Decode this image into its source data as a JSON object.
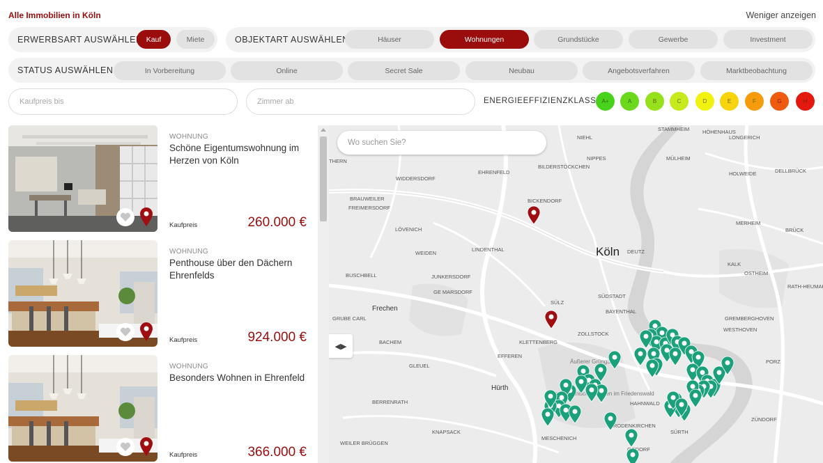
{
  "header": {
    "title": "Alle Immobilien in Köln",
    "less_label": "Weniger anzeigen"
  },
  "acquisition": {
    "label": "ERWERBSART AUSWÄHLEN",
    "options": [
      {
        "label": "Kauf",
        "active": true
      },
      {
        "label": "Miete",
        "active": false
      }
    ]
  },
  "object_type": {
    "label": "OBJEKTART AUSWÄHLEN",
    "options": [
      {
        "label": "Häuser",
        "active": false
      },
      {
        "label": "Wohnungen",
        "active": true
      },
      {
        "label": "Grundstücke",
        "active": false
      },
      {
        "label": "Gewerbe",
        "active": false
      },
      {
        "label": "Investment",
        "active": false
      }
    ]
  },
  "status": {
    "label": "STATUS AUSWÄHLEN",
    "options": [
      {
        "label": "In Vorbereitung"
      },
      {
        "label": "Online"
      },
      {
        "label": "Secret Sale"
      },
      {
        "label": "Neubau"
      },
      {
        "label": "Angebotsverfahren"
      },
      {
        "label": "Marktbeobachtung"
      }
    ]
  },
  "inputs": {
    "price_placeholder": "Kaufpreis bis",
    "rooms_placeholder": "Zimmer ab"
  },
  "energy": {
    "label": "ENERGIEEFFIZIENZKLASSE",
    "classes": [
      {
        "label": "A+",
        "color": "#49d21b"
      },
      {
        "label": "A",
        "color": "#6bd81c"
      },
      {
        "label": "B",
        "color": "#96e01c"
      },
      {
        "label": "C",
        "color": "#c6ea1c"
      },
      {
        "label": "D",
        "color": "#f1f20f"
      },
      {
        "label": "E",
        "color": "#f7d40c"
      },
      {
        "label": "F",
        "color": "#f69b0c"
      },
      {
        "label": "G",
        "color": "#ee5a10"
      },
      {
        "label": "H",
        "color": "#e3180f"
      }
    ]
  },
  "listings": [
    {
      "type": "WOHNUNG",
      "title": "Schöne Eigentumswohnung im Herzen von Köln",
      "price_label": "Kaufpreis",
      "price": "260.000 €"
    },
    {
      "type": "WOHNUNG",
      "title": "Penthouse über den Dächern Ehrenfelds",
      "price_label": "Kaufpreis",
      "price": "924.000 €"
    },
    {
      "type": "WOHNUNG",
      "title": "Besonders Wohnen in Ehrenfeld",
      "price_label": "Kaufpreis",
      "price": "366.000 €"
    }
  ],
  "map": {
    "search_placeholder": "Wo suchen Sie?",
    "toggle_glyph": "◀▶",
    "city_label": "Köln",
    "labels": [
      "STAMMHEIM",
      "HÖHENHAUS",
      "NIEHL",
      "LONGERICH",
      "BICKENDORF",
      "NIPPES",
      "MÜLHEIM",
      "HOLWEIDE",
      "DELLBRÜCK",
      "EHRENFELD",
      "BILDERSTÖCKCHEN",
      "WIDDERSDORF",
      "BRAUWEILER",
      "FREIMERSDORF",
      "LÖVENICH",
      "LINDENTHAL",
      "DEUTZ",
      "MERHEIM",
      "BRÜCK",
      "WEIDEN",
      "JUNKERSDORF",
      "BUSCHBELL",
      "GE MARSDORF",
      "KALK",
      "OSTHEIM",
      "RATH-HEUMAR",
      "Frechen",
      "SÜLZ",
      "SÜDSTADT",
      "ZOLLSTOCK",
      "GRUBE CARL",
      "BAYENTHAL",
      "BACHEM",
      "KLETTENBERG",
      "WESTHOVEN",
      "GREMBERGHOVEN",
      "EFFEREN",
      "PORZ",
      "GLEUEL",
      "Äußerer Grüngürtel",
      "Hürth",
      "Forstbotanischer Garten im Friedenswald",
      "HAHNWALD",
      "BERRENRATH",
      "SÜRTH",
      "ZÜNDORF",
      "KNAPSACK",
      "RODENKIRCHEN",
      "GODORF",
      "MESCHENICH",
      "WEILER BRÜGGEN",
      "THERN"
    ]
  }
}
